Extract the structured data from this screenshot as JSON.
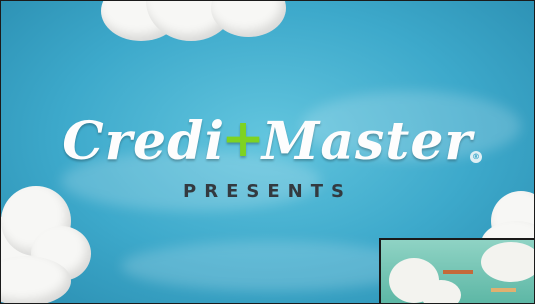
{
  "video": {
    "brand_left": "Credi",
    "brand_plus": "+",
    "brand_right": "Master",
    "registered_mark": "®",
    "subtitle": "PRESENTS",
    "brand_accent_color": "#7ed321",
    "sky_color": "#3da9cb"
  }
}
